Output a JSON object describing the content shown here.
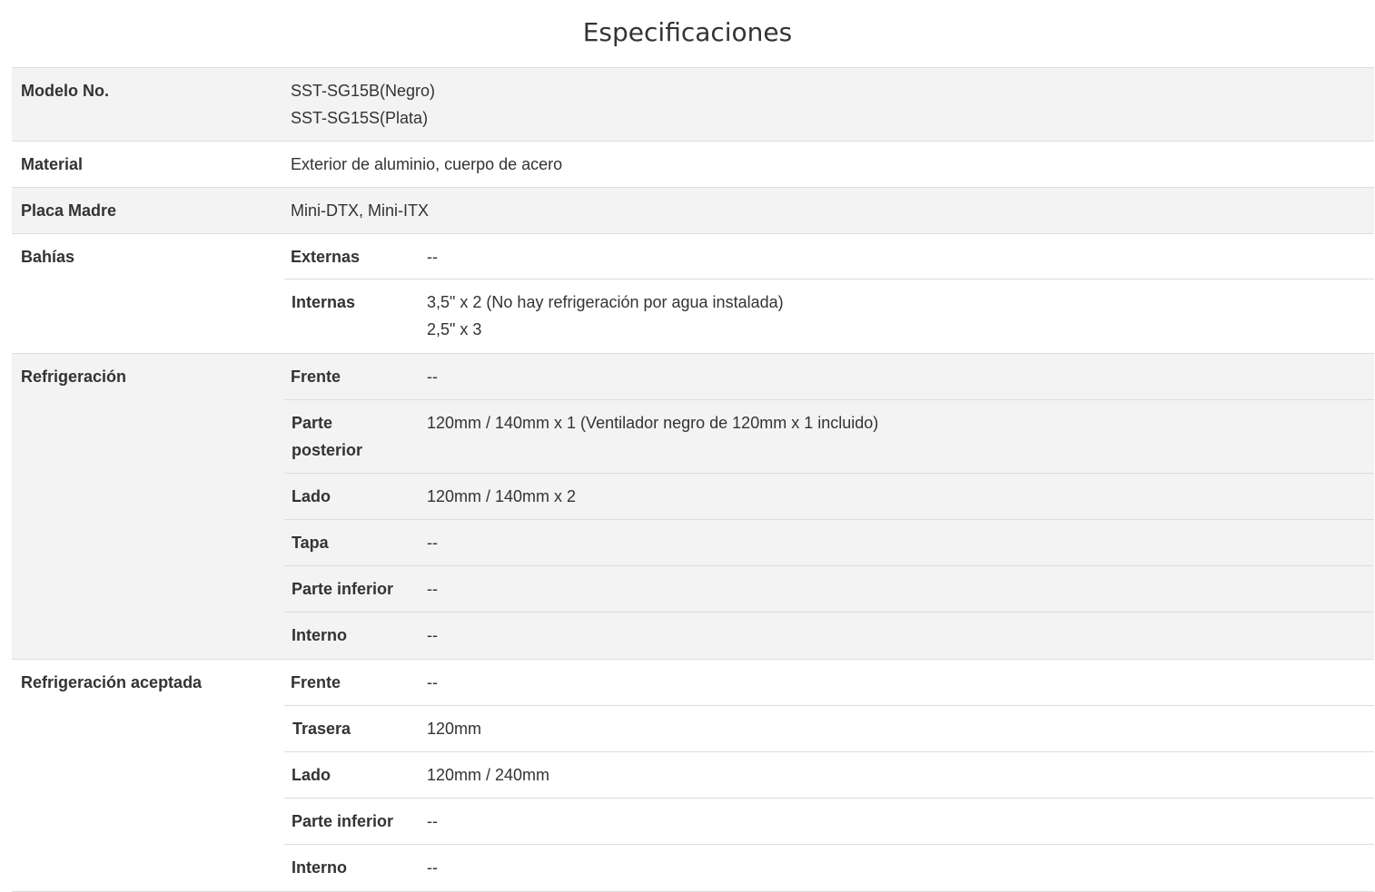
{
  "page": {
    "title": "Especificaciones"
  },
  "specs": {
    "modelo": {
      "label": "Modelo No.",
      "values": [
        "SST-SG15B(Negro)",
        "SST-SG15S(Plata)"
      ]
    },
    "material": {
      "label": "Material",
      "value": "Exterior de aluminio, cuerpo de acero"
    },
    "placa_madre": {
      "label": "Placa Madre",
      "value": "Mini-DTX, Mini-ITX"
    },
    "bahias": {
      "label": "Bahías",
      "rows": [
        {
          "label": "Externas",
          "values": [
            "--"
          ]
        },
        {
          "label": "Internas",
          "values": [
            "3,5\" x 2 (No hay refrigeración por agua instalada)",
            "2,5\" x 3"
          ]
        }
      ]
    },
    "refrigeracion": {
      "label": "Refrigeración",
      "rows": [
        {
          "label": "Frente",
          "values": [
            "--"
          ]
        },
        {
          "label": "Parte posterior",
          "label_lines": [
            "Parte",
            "posterior"
          ],
          "values": [
            "120mm / 140mm x 1 (Ventilador negro de 120mm x 1 incluido)"
          ]
        },
        {
          "label": "Lado",
          "values": [
            "120mm / 140mm x 2"
          ]
        },
        {
          "label": "Tapa",
          "values": [
            "--"
          ]
        },
        {
          "label": "Parte inferior",
          "values": [
            "--"
          ]
        },
        {
          "label": "Interno",
          "values": [
            "--"
          ]
        }
      ]
    },
    "refrigeracion_aceptada": {
      "label": "Refrigeración aceptada",
      "rows": [
        {
          "label": "Frente",
          "values": [
            "--"
          ]
        },
        {
          "label": "Trasera",
          "values": [
            "120mm"
          ]
        },
        {
          "label": "Lado",
          "values": [
            "120mm / 240mm"
          ]
        },
        {
          "label": "Parte inferior",
          "values": [
            "--"
          ]
        },
        {
          "label": "Interno",
          "values": [
            "--"
          ]
        }
      ]
    }
  }
}
